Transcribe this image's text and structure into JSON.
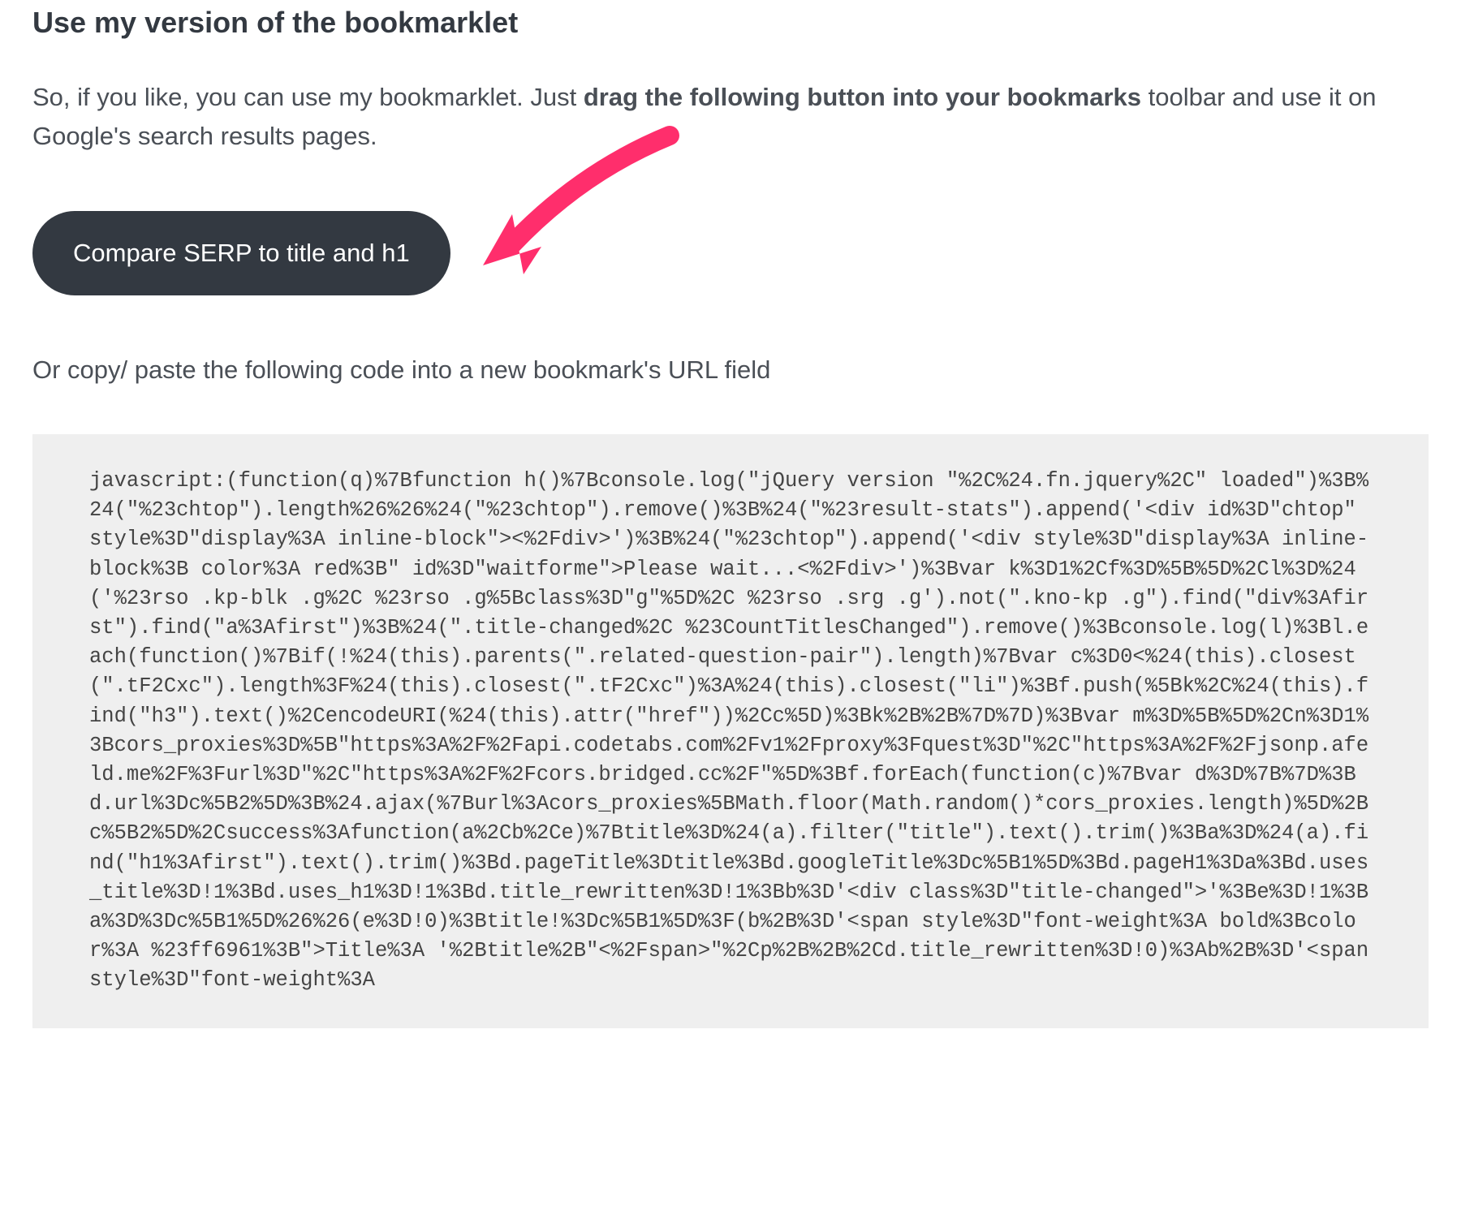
{
  "heading": "Use my version of the bookmarklet",
  "intro_pre": "So, if you like, you can use my bookmarklet. Just ",
  "intro_bold": "drag the following button into your bookmarks",
  "intro_post": " toolbar and use it on Google's search results pages.",
  "button_label": "Compare SERP to title and h1",
  "sub_instruction": "Or copy/ paste the following code into a new bookmark's URL field",
  "code": "javascript:(function(q)%7Bfunction h()%7Bconsole.log(\"jQuery version \"%2C%24.fn.jquery%2C\" loaded\")%3B%24(\"%23chtop\").length%26%26%24(\"%23chtop\").remove()%3B%24(\"%23result-stats\").append('<div id%3D\"chtop\" style%3D\"display%3A inline-block\"><%2Fdiv>')%3B%24(\"%23chtop\").append('<div style%3D\"display%3A inline-block%3B color%3A red%3B\" id%3D\"waitforme\">Please wait...<%2Fdiv>')%3Bvar k%3D1%2Cf%3D%5B%5D%2Cl%3D%24('%23rso .kp-blk .g%2C %23rso .g%5Bclass%3D\"g\"%5D%2C %23rso .srg .g').not(\".kno-kp .g\").find(\"div%3Afirst\").find(\"a%3Afirst\")%3B%24(\".title-changed%2C %23CountTitlesChanged\").remove()%3Bconsole.log(l)%3Bl.each(function()%7Bif(!%24(this).parents(\".related-question-pair\").length)%7Bvar c%3D0<%24(this).closest(\".tF2Cxc\").length%3F%24(this).closest(\".tF2Cxc\")%3A%24(this).closest(\"li\")%3Bf.push(%5Bk%2C%24(this).find(\"h3\").text()%2CencodeURI(%24(this).attr(\"href\"))%2Cc%5D)%3Bk%2B%2B%7D%7D)%3Bvar m%3D%5B%5D%2Cn%3D1%3Bcors_proxies%3D%5B\"https%3A%2F%2Fapi.codetabs.com%2Fv1%2Fproxy%3Fquest%3D\"%2C\"https%3A%2F%2Fjsonp.afeld.me%2F%3Furl%3D\"%2C\"https%3A%2F%2Fcors.bridged.cc%2F\"%5D%3Bf.forEach(function(c)%7Bvar d%3D%7B%7D%3Bd.url%3Dc%5B2%5D%3B%24.ajax(%7Burl%3Acors_proxies%5BMath.floor(Math.random()*cors_proxies.length)%5D%2Bc%5B2%5D%2Csuccess%3Afunction(a%2Cb%2Ce)%7Btitle%3D%24(a).filter(\"title\").text().trim()%3Ba%3D%24(a).find(\"h1%3Afirst\").text().trim()%3Bd.pageTitle%3Dtitle%3Bd.googleTitle%3Dc%5B1%5D%3Bd.pageH1%3Da%3Bd.uses_title%3D!1%3Bd.uses_h1%3D!1%3Bd.title_rewritten%3D!1%3Bb%3D'<div class%3D\"title-changed\">'%3Be%3D!1%3Ba%3D%3Dc%5B1%5D%26%26(e%3D!0)%3Btitle!%3Dc%5B1%5D%3F(b%2B%3D'<span style%3D\"font-weight%3A bold%3Bcolor%3A %23ff6961%3B\">Title%3A '%2Btitle%2B\"<%2Fspan>\"%2Cp%2B%2B%2Cd.title_rewritten%3D!0)%3Ab%2B%3D'<span style%3D\"font-weight%3A"
}
